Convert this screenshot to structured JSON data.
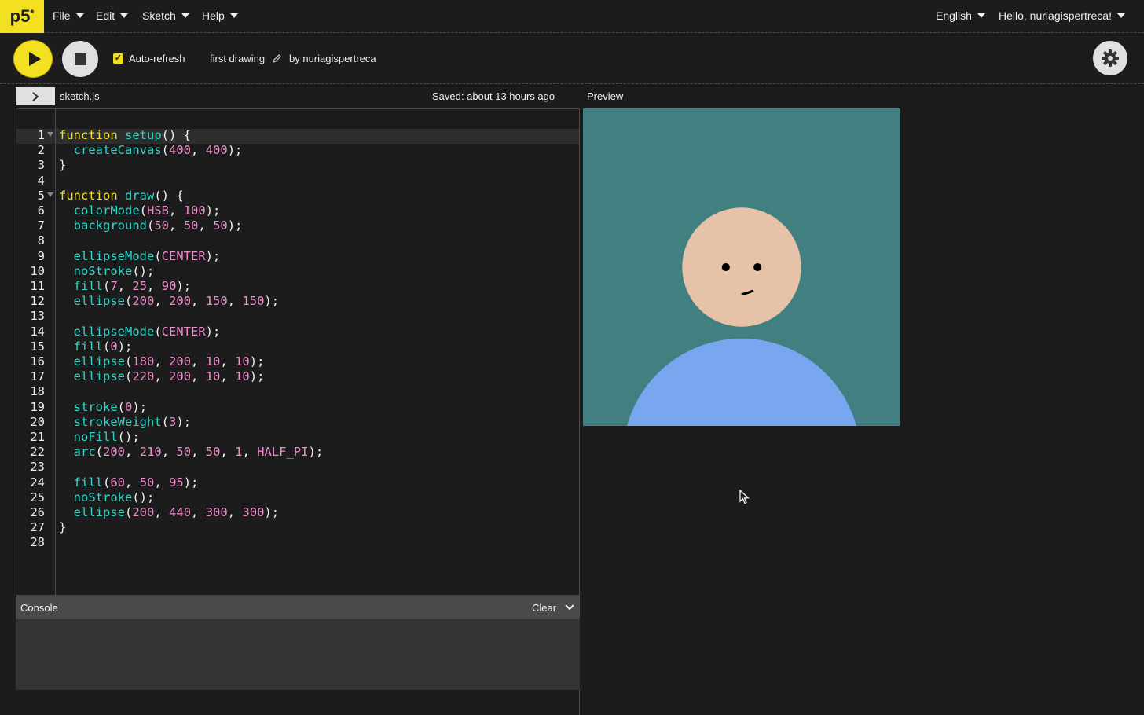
{
  "nav": {
    "logo": "p5",
    "logo_mark": "*",
    "menus": [
      "File",
      "Edit",
      "Sketch",
      "Help"
    ],
    "language": "English",
    "user": "Hello, nuriagispertreca!"
  },
  "toolbar": {
    "auto_refresh_label": "Auto-refresh",
    "auto_refresh_checked": true,
    "sketch_name": "first drawing",
    "author": "by nuriagispertreca"
  },
  "editor": {
    "file_name": "sketch.js",
    "saved_status": "Saved: about 13 hours ago",
    "line_numbers": [
      "1",
      "2",
      "3",
      "4",
      "5",
      "6",
      "7",
      "8",
      "9",
      "10",
      "11",
      "12",
      "13",
      "14",
      "15",
      "16",
      "17",
      "18",
      "19",
      "20",
      "21",
      "22",
      "23",
      "24",
      "25",
      "26",
      "27",
      "28"
    ],
    "lines": [
      "function setup() {",
      "  createCanvas(400, 400);",
      "}",
      "",
      "function draw() {",
      "  colorMode(HSB, 100);",
      "  background(50, 50, 50);",
      "",
      "  ellipseMode(CENTER);",
      "  noStroke();",
      "  fill(7, 25, 90);",
      "  ellipse(200, 200, 150, 150);",
      "",
      "  ellipseMode(CENTER);",
      "  fill(0);",
      "  ellipse(180, 200, 10, 10);",
      "  ellipse(220, 200, 10, 10);",
      "",
      "  stroke(0);",
      "  strokeWeight(3);",
      "  noFill();",
      "  arc(200, 210, 50, 50, 1, HALF_PI);",
      "",
      "  fill(60, 50, 95);",
      "  noStroke();",
      "  ellipse(200, 440, 300, 300);",
      "}",
      ""
    ]
  },
  "console": {
    "label": "Console",
    "clear_label": "Clear"
  },
  "preview": {
    "label": "Preview",
    "background_color": "#417f80",
    "face_color": "#e6c3a8",
    "body_color": "#78a7f0"
  },
  "colors": {
    "accent": "#f2e021",
    "background": "#1c1c1c"
  }
}
